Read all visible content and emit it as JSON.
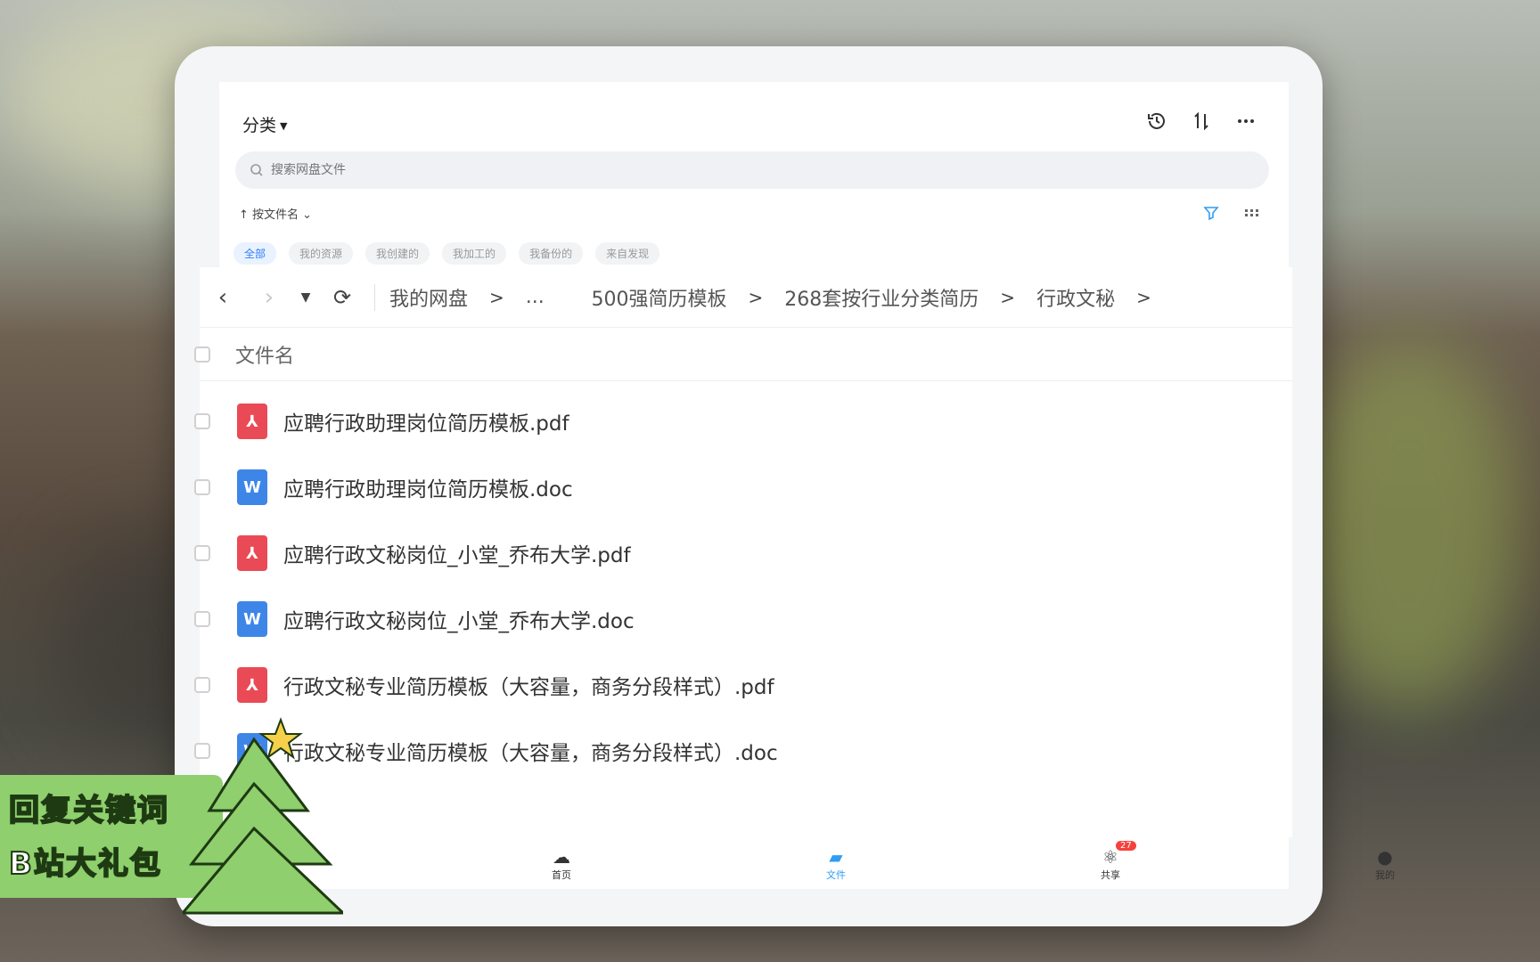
{
  "app": {
    "category_label": "分类",
    "search_placeholder": "搜索网盘文件",
    "sort_label": "按文件名",
    "filter_chips": [
      "全部",
      "我的资源",
      "我创建的",
      "我加工的",
      "我备份的",
      "来自发现"
    ]
  },
  "breadcrumb": {
    "items": [
      "我的网盘",
      "...",
      "500强简历模板",
      "268套按行业分类简历",
      "行政文秘"
    ]
  },
  "file_list": {
    "header": "文件名",
    "files": [
      {
        "name": "应聘行政助理岗位简历模板.pdf",
        "type": "pdf",
        "icon": "pdf-file-icon"
      },
      {
        "name": "应聘行政助理岗位简历模板.doc",
        "type": "doc",
        "icon": "word-file-icon"
      },
      {
        "name": "应聘行政文秘岗位_小堂_乔布大学.pdf",
        "type": "pdf",
        "icon": "pdf-file-icon"
      },
      {
        "name": "应聘行政文秘岗位_小堂_乔布大学.doc",
        "type": "doc",
        "icon": "word-file-icon"
      },
      {
        "name": "行政文秘专业简历模板（大容量，商务分段样式）.pdf",
        "type": "pdf",
        "icon": "pdf-file-icon"
      },
      {
        "name": "行政文秘专业简历模板（大容量，商务分段样式）.doc",
        "type": "doc",
        "icon": "word-file-icon"
      }
    ]
  },
  "tabbar": {
    "tabs": [
      {
        "label": "首页",
        "icon": "cloud-icon"
      },
      {
        "label": "文件",
        "icon": "folder-icon",
        "active": true
      },
      {
        "label": "共享",
        "icon": "share-icon",
        "badge": "27"
      },
      {
        "label": "我的",
        "icon": "avatar-icon"
      }
    ]
  },
  "promo": {
    "line1": "回复关键词",
    "line2": "B站大礼包"
  },
  "colors": {
    "accent": "#2f9cf5",
    "pdf": "#ea4a55",
    "doc": "#3d86e8",
    "badge": "#f5423d",
    "promo_bg": "#8fcf6e"
  }
}
